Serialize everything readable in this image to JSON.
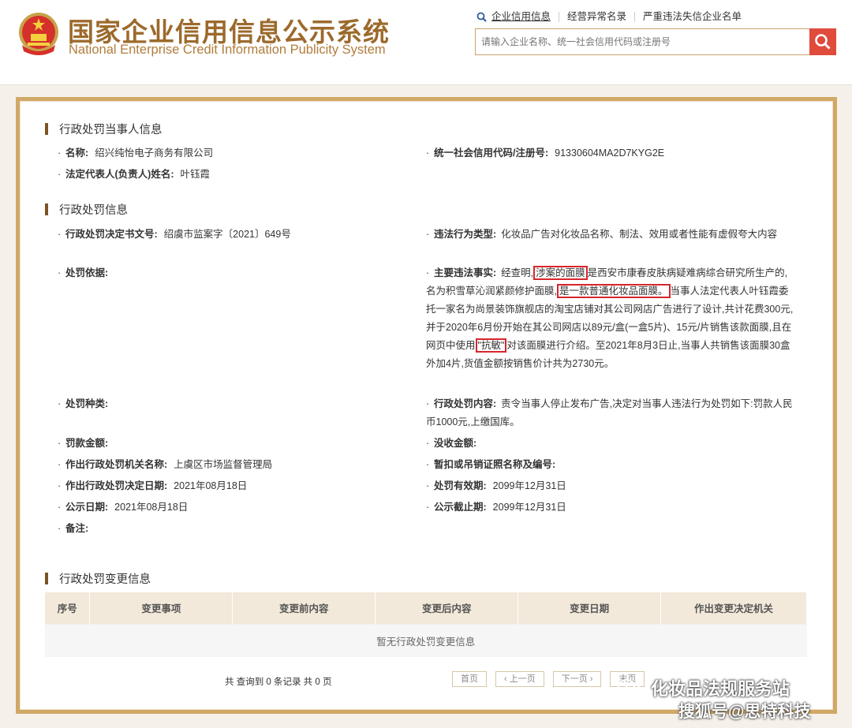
{
  "header": {
    "title_cn": "国家企业信用信息公示系统",
    "title_en": "National Enterprise Credit Information Publicity System",
    "nav": [
      {
        "label": "企业信用信息"
      },
      {
        "label": "经营异常名录"
      },
      {
        "label": "严重违法失信企业名单"
      }
    ],
    "search_placeholder": "请输入企业名称、统一社会信用代码或注册号"
  },
  "party": {
    "section_title": "行政处罚当事人信息",
    "name_label": "名称:",
    "name_value": "绍兴纯怡电子商务有限公司",
    "code_label": "统一社会信用代码/注册号:",
    "code_value": "91330604MA2D7KYG2E",
    "rep_label": "法定代表人(负责人)姓名:",
    "rep_value": "叶钰霞"
  },
  "penalty": {
    "section_title": "行政处罚信息",
    "doc_no_label": "行政处罚决定书文号:",
    "doc_no_value": "绍虞市监案字〔2021〕649号",
    "violation_type_label": "违法行为类型:",
    "violation_type_value": "化妆品广告对化妆品名称、制法、效用或者性能有虚假夸大内容",
    "basis_label": "处罚依据:",
    "facts_label": "主要违法事实:",
    "facts_p1": "经查明,",
    "facts_hl1": "涉案的面膜",
    "facts_p2": "是西安市康春皮肤病疑难病综合研究所生产的,名为积雪草沁润紧颜修护面膜,",
    "facts_hl2": "是一款普通化妆品面膜。",
    "facts_p3": "当事人法定代表人叶钰霞委托一家名为尚景装饰旗舰店的淘宝店铺对其公司网店广告进行了设计,共计花费300元,并于2020年6月份开始在其公司网店以89元/盒(一盒5片)、15元/片销售该款面膜,且在网页中使用",
    "facts_hl3": "\"抗敏\"",
    "facts_p4": "对该面膜进行介绍。至2021年8月3日止,当事人共销售该面膜30盒外加4片,货值金额按销售价计共为2730元。",
    "kind_label": "处罚种类:",
    "content_label": "行政处罚内容:",
    "content_value": "责令当事人停止发布广告,决定对当事人违法行为处罚如下:罚款人民币1000元,上缴国库。",
    "fine_label": "罚款金额:",
    "confiscate_label": "没收金额:",
    "authority_label": "作出行政处罚机关名称:",
    "authority_value": "上虞区市场监督管理局",
    "license_label": "暂扣或吊销证照名称及编号:",
    "decision_date_label": "作出行政处罚决定日期:",
    "decision_date_value": "2021年08月18日",
    "valid_label": "处罚有效期:",
    "valid_value": "2099年12月31日",
    "publish_label": "公示日期:",
    "publish_value": "2021年08月18日",
    "publish_end_label": "公示截止期:",
    "publish_end_value": "2099年12月31日",
    "remark_label": "备注:"
  },
  "changes": {
    "section_title": "行政处罚变更信息",
    "columns": [
      "序号",
      "变更事项",
      "变更前内容",
      "变更后内容",
      "变更日期",
      "作出变更决定机关"
    ],
    "empty_text": "暂无行政处罚变更信息",
    "pager_info": "共 查询到 0 条记录 共 0 页",
    "pager_buttons": [
      "首页",
      "‹ 上一页",
      "下一页 ›",
      "末页"
    ]
  },
  "watermark": {
    "line1": "化妆品法规服务站",
    "line2": "搜狐号@思特科技"
  }
}
